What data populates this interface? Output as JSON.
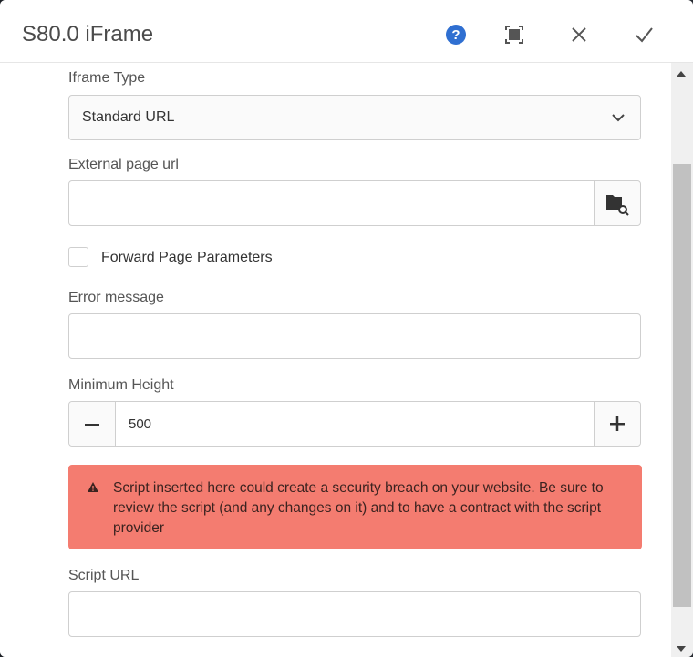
{
  "dialog": {
    "title": "S80.0 iFrame"
  },
  "toolbar": {
    "help_icon": "help-icon",
    "fullscreen_icon": "fullscreen-icon",
    "close_icon": "close-icon",
    "confirm_icon": "check-icon"
  },
  "form": {
    "iframe_type": {
      "label": "Iframe Type",
      "value": "Standard URL"
    },
    "external_url": {
      "label": "External page url",
      "value": ""
    },
    "forward_params": {
      "label": "Forward Page Parameters",
      "checked": false
    },
    "error_message": {
      "label": "Error message",
      "value": ""
    },
    "min_height": {
      "label": "Minimum Height",
      "value": "500"
    },
    "alert": {
      "text": "Script inserted here could create a security breach on your website. Be sure to review the script (and any changes on it) and to have a contract with the script provider"
    },
    "script_url": {
      "label": "Script URL",
      "value": ""
    }
  },
  "colors": {
    "accent": "#2f6fd1",
    "alert_bg": "#f47c70"
  }
}
